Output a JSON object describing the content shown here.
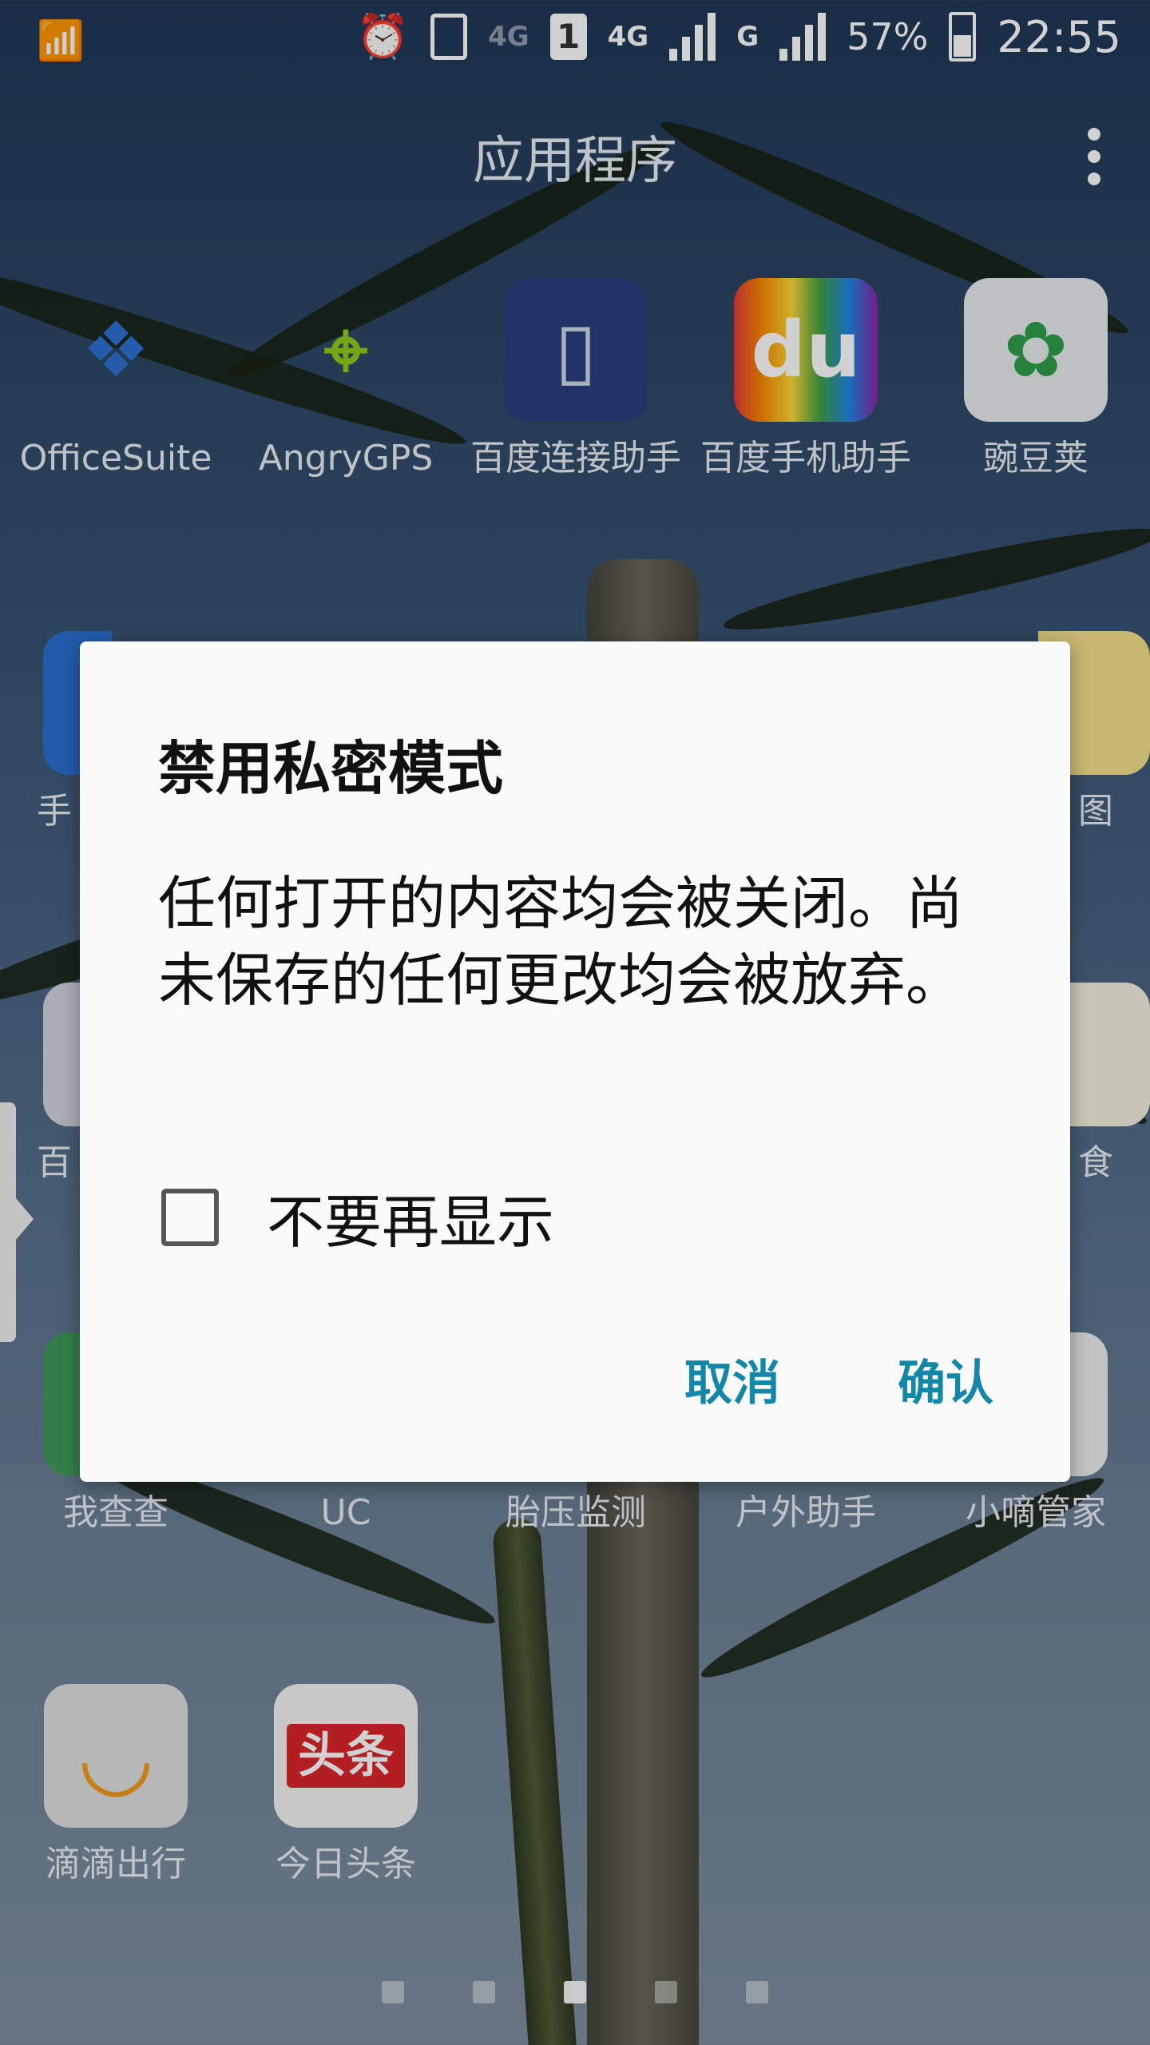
{
  "status_bar": {
    "signal_label": "4G",
    "sim_label": "1",
    "network2_label": "4G",
    "network3_label": "G",
    "battery": "57%",
    "time": "22:55"
  },
  "header": {
    "title": "应用程序"
  },
  "apps": [
    {
      "label": "OfficeSuite",
      "icon": "officesuite-icon",
      "color": "#2c6fd0"
    },
    {
      "label": "AngryGPS",
      "icon": "angrygps-icon",
      "color": "#8ecb1a"
    },
    {
      "label": "百度连接助手",
      "icon": "baidu-connect-icon",
      "color": "#2a3f7e"
    },
    {
      "label": "百度手机助手",
      "icon": "baidu-assistant-icon",
      "color": "#e8e8e8"
    },
    {
      "label": "豌豆荚",
      "icon": "wandoujia-icon",
      "color": "#e8ecec"
    },
    {
      "label": "我查查",
      "icon": "wochacha-icon",
      "color": "#3f9a5a"
    },
    {
      "label": "UC",
      "icon": "uc-icon",
      "color": "#f08a1c"
    },
    {
      "label": "胎压监测",
      "icon": "tire-pressure-icon",
      "color": "#444444"
    },
    {
      "label": "户外助手",
      "icon": "outdoor-icon",
      "color": "#2d6bb0"
    },
    {
      "label": "小嘀管家",
      "icon": "xiaodi-icon",
      "color": "#eeeeee"
    },
    {
      "label": "滴滴出行",
      "icon": "didi-icon",
      "color": "#e0e0e0"
    },
    {
      "label": "今日头条",
      "icon": "toutiao-icon",
      "color": "#d9252a"
    }
  ],
  "partial_labels": {
    "row2_left": "手",
    "row2_right": "图",
    "row3_left": "百",
    "row3_right": "食"
  },
  "dialog": {
    "title": "禁用私密模式",
    "message": "任何打开的内容均会被关闭。尚未保存的任何更改均会被放弃。",
    "checkbox_label": "不要再显示",
    "checkbox_checked": false,
    "cancel_label": "取消",
    "confirm_label": "确认",
    "accent_color": "#1287a8"
  },
  "pager": {
    "pages": 5,
    "active_index": 2
  }
}
